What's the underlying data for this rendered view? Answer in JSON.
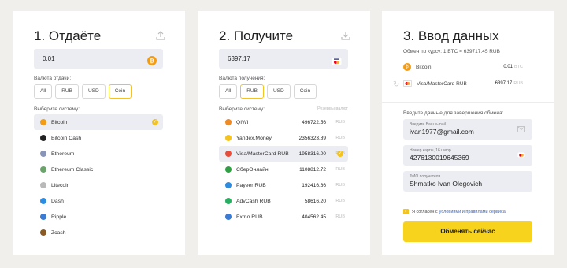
{
  "step1": {
    "title": "1. Отдаёте",
    "amount": "0.01",
    "currency_label": "Валюта отдачи:",
    "tabs": [
      "All",
      "RUB",
      "USD",
      "Coin"
    ],
    "active_tab": "Coin",
    "system_label": "Выберите систему:",
    "items": [
      {
        "name": "Bitcoin",
        "icon": "bitcoin-icon",
        "color": "#f39c12",
        "selected": true
      },
      {
        "name": "Bitcoin Cash",
        "icon": "bitcoin-cash-icon",
        "color": "#222222"
      },
      {
        "name": "Ethereum",
        "icon": "ethereum-icon",
        "color": "#8894b8"
      },
      {
        "name": "Ethereum Classic",
        "icon": "ethereum-classic-icon",
        "color": "#6aa46a"
      },
      {
        "name": "Litecoin",
        "icon": "litecoin-icon",
        "color": "#b9b9b9"
      },
      {
        "name": "Dash",
        "icon": "dash-icon",
        "color": "#2d8ce0"
      },
      {
        "name": "Ripple",
        "icon": "ripple-icon",
        "color": "#3a7bd5"
      },
      {
        "name": "Zcash",
        "icon": "zcash-icon",
        "color": "#8a5a22"
      }
    ]
  },
  "step2": {
    "title": "2. Получите",
    "amount": "6397.17",
    "currency_label": "Валюта получения:",
    "tabs": [
      "All",
      "RUB",
      "USD",
      "Coin"
    ],
    "active_tab": "RUB",
    "system_label": "Выберите систему:",
    "reserve_label": "Резервы валют",
    "items": [
      {
        "name": "QIWI",
        "amount": "496722.56",
        "cur": "RUB",
        "icon": "qiwi-icon",
        "color": "#f08a24"
      },
      {
        "name": "Yandex.Money",
        "amount": "2356323.89",
        "cur": "RUB",
        "icon": "yandex-money-icon",
        "color": "#f3c31f"
      },
      {
        "name": "Visa/MasterCard RUB",
        "amount": "1958316.00",
        "cur": "RUB",
        "icon": "card-icon",
        "color": "#e74c3c",
        "selected": true
      },
      {
        "name": "СберОнлайн",
        "amount": "1108812.72",
        "cur": "RUB",
        "icon": "sber-icon",
        "color": "#2ea043"
      },
      {
        "name": "Payeer RUB",
        "amount": "192416.66",
        "cur": "RUB",
        "icon": "payeer-icon",
        "color": "#2d8ce0"
      },
      {
        "name": "AdvCash RUB",
        "amount": "58616.20",
        "cur": "RUB",
        "icon": "advcash-icon",
        "color": "#27ae60"
      },
      {
        "name": "Exmo RUB",
        "amount": "404562.45",
        "cur": "RUB",
        "icon": "exmo-icon",
        "color": "#3a7bd5"
      }
    ]
  },
  "step3": {
    "title": "3. Ввод данных",
    "rate": "Обмен по курсу: 1 BTC  =  639717.45 RUB",
    "from": {
      "name": "Bitcoin",
      "amount": "0.01",
      "cur": "BTC"
    },
    "to": {
      "name": "Visa/MasterCard RUB",
      "amount": "6397.17",
      "cur": "RUB"
    },
    "data_label": "Введите данные для завершения обмена:",
    "email": {
      "label": "Введите Ваш e-mail",
      "value": "ivan1977@gmail.com"
    },
    "card": {
      "label": "Номер карты, 16 цифр",
      "value": "4276130019645369"
    },
    "fio": {
      "label": "ФИО получателя",
      "value": "Shmatko Ivan Olegovich"
    },
    "agree_text": "Я согласен с",
    "agree_link": "условиями и правилами сервиса",
    "submit_label": "Обменять сейчас"
  },
  "colors": {
    "accent": "#f3c31f",
    "button": "#f8d31d",
    "field": "#ecedf2",
    "link": "#3a6ac8"
  }
}
